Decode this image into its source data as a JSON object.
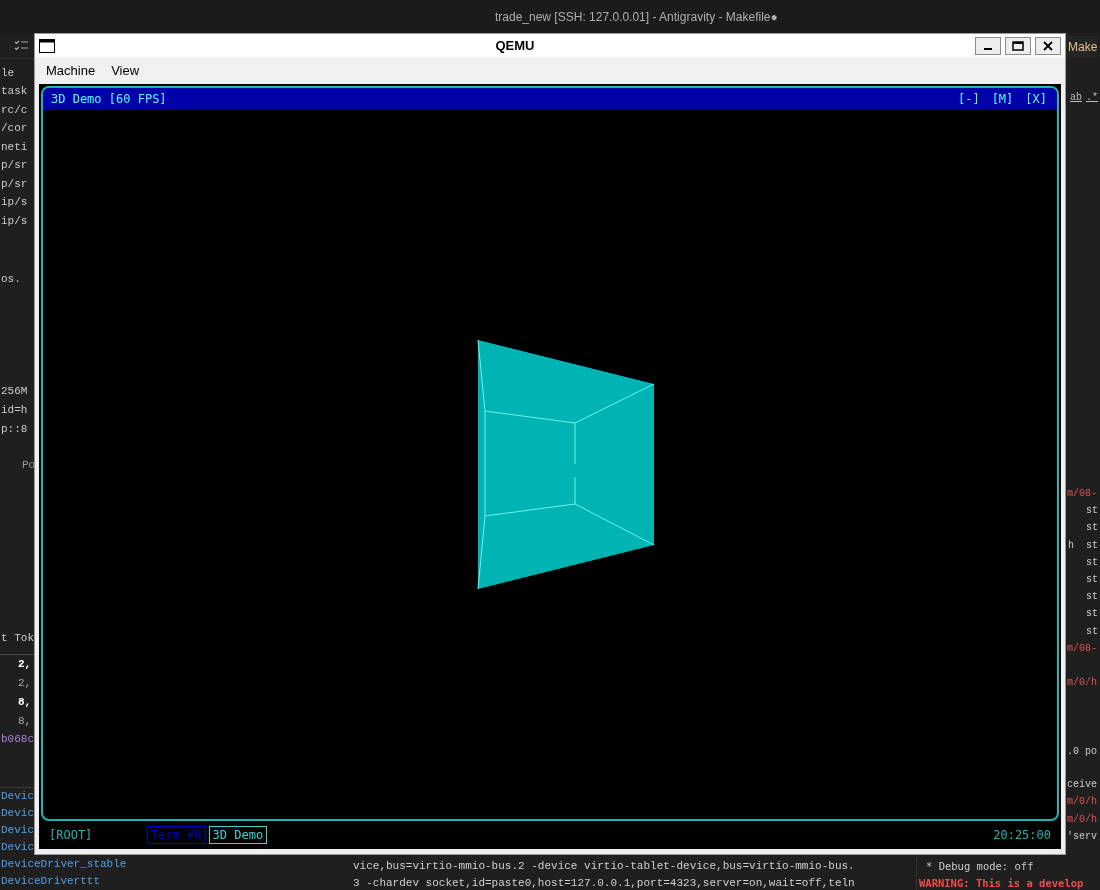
{
  "editor_title": "trade_new [SSH: 127.0.0.01] - Antigravity - Makefile●",
  "left_pane": {
    "header": "le",
    "lines": [
      "task",
      "rc/c",
      "/cor",
      "neti",
      "p/sr",
      "p/sr",
      "ip/s",
      "ip/s"
    ],
    "line_os": "os.",
    "command_lines": [
      "256M",
      "id=h",
      "p::8"
    ],
    "panel_tab": "Po",
    "token_header": "t Tok",
    "token_values": [
      {
        "text": "2,",
        "bold": true
      },
      {
        "text": "2,",
        "bold": false
      },
      {
        "text": "8,",
        "bold": true
      },
      {
        "text": "8,",
        "bold": false
      }
    ],
    "hash": "b068c",
    "outline": [
      "Devic",
      "Devic",
      "Devic",
      "Devic",
      "DeviceDriver_stable",
      "DeviceDriverttt"
    ]
  },
  "right_pane": {
    "tab": "Make",
    "find_options": [
      "ab",
      ".*"
    ],
    "output_blocks": [
      [
        {
          "text": "m/08-",
          "kind": "path"
        },
        {
          "text": "st",
          "kind": "plain"
        },
        {
          "text": "st",
          "kind": "plain"
        },
        {
          "text": "h  st",
          "kind": "plain"
        },
        {
          "text": "st",
          "kind": "plain"
        },
        {
          "text": "st",
          "kind": "plain"
        },
        {
          "text": "st",
          "kind": "plain"
        },
        {
          "text": "st",
          "kind": "plain"
        },
        {
          "text": "st",
          "kind": "plain"
        },
        {
          "text": "m/08-",
          "kind": "path"
        }
      ],
      [
        {
          "text": "m/0/h",
          "kind": "path"
        }
      ],
      [
        {
          "text": ".0 po",
          "kind": "text"
        }
      ],
      [
        {
          "text": "ceive",
          "kind": "text"
        },
        {
          "text": "m/0/h",
          "kind": "path"
        },
        {
          "text": "m/0/h",
          "kind": "path"
        },
        {
          "text": "'serv",
          "kind": "text"
        }
      ]
    ]
  },
  "terminal": {
    "lines": [
      "vice,bus=virtio-mmio-bus.2 -device virtio-tablet-device,bus=virtio-mmio-bus.",
      "3 -chardev socket,id=paste0,host=127.0.0.1,port=4323,server=on,wait=off,teln"
    ]
  },
  "server_log": {
    "lines": [
      {
        "text": "* Debug mode: off",
        "kind": "info"
      },
      {
        "text": "WARNING: This is a develop",
        "kind": "warning"
      }
    ]
  },
  "qemu": {
    "title": "QEMU",
    "menu": [
      "Machine",
      "View"
    ],
    "demo_window": {
      "title": "3D Demo [60 FPS]",
      "controls": [
        "[-]",
        "[M]",
        "[X]"
      ]
    },
    "taskbar": {
      "root": "[ROOT]",
      "tasks": [
        {
          "label": "Term #0",
          "selected": false
        },
        {
          "label": "3D Demo",
          "selected": true
        }
      ],
      "clock": "20:25:00"
    }
  }
}
